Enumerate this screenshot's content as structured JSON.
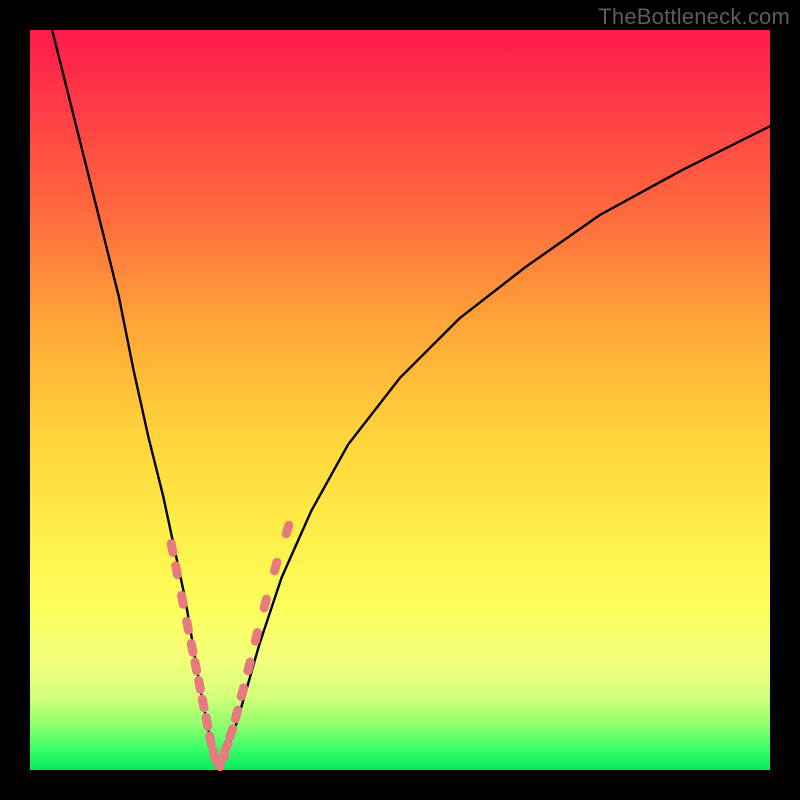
{
  "watermark": "TheBottleneck.com",
  "colors": {
    "frame": "#000000",
    "curve_stroke": "#000000",
    "marker_fill": "#e77a7f",
    "gradient_top": "#ff1a4b",
    "gradient_mid": "#ffee48",
    "gradient_bottom": "#07e85e"
  },
  "chart_data": {
    "type": "line",
    "title": "",
    "xlabel": "",
    "ylabel": "",
    "xlim": [
      0,
      100
    ],
    "ylim": [
      0,
      100
    ],
    "note": "x is horizontal position (% of plot width), y is vertical position (% of plot height, 0 = top, 100 = bottom). Curve is a sharp V / notch centered near x≈25, reaching y≈100 at the bottom, with a shallower rise on the right reaching y≈12 at x=100.",
    "series": [
      {
        "name": "bottleneck-curve",
        "x": [
          3,
          6,
          9,
          12,
          14,
          16,
          18,
          19.5,
          21,
          22,
          23,
          24,
          24.8,
          25.5,
          26.5,
          27.5,
          29,
          31,
          34,
          38,
          43,
          50,
          58,
          67,
          77,
          88,
          100
        ],
        "y": [
          0,
          12,
          24,
          36,
          46,
          55,
          63,
          70,
          77,
          83,
          89,
          94,
          98,
          99.5,
          98,
          95,
          90,
          83,
          74,
          65,
          56,
          47,
          39,
          32,
          25,
          19,
          13
        ]
      }
    ],
    "markers": {
      "name": "highlighted-points",
      "note": "Salmon markers clustered on both flanks of the notch between roughly y=70 and y=99.",
      "shape": "rounded-pill",
      "x": [
        19.2,
        19.8,
        20.6,
        21.3,
        21.9,
        22.4,
        22.9,
        23.4,
        23.9,
        24.4,
        24.9,
        25.4,
        25.9,
        26.5,
        27.2,
        27.9,
        28.7,
        29.6,
        30.6,
        31.8,
        33.2,
        34.8
      ],
      "y": [
        70.0,
        73.0,
        77.0,
        80.5,
        83.5,
        86.0,
        88.5,
        91.0,
        93.5,
        96.0,
        98.0,
        99.0,
        98.5,
        97.0,
        95.0,
        92.5,
        89.5,
        86.0,
        82.0,
        77.5,
        72.5,
        67.5
      ]
    }
  }
}
